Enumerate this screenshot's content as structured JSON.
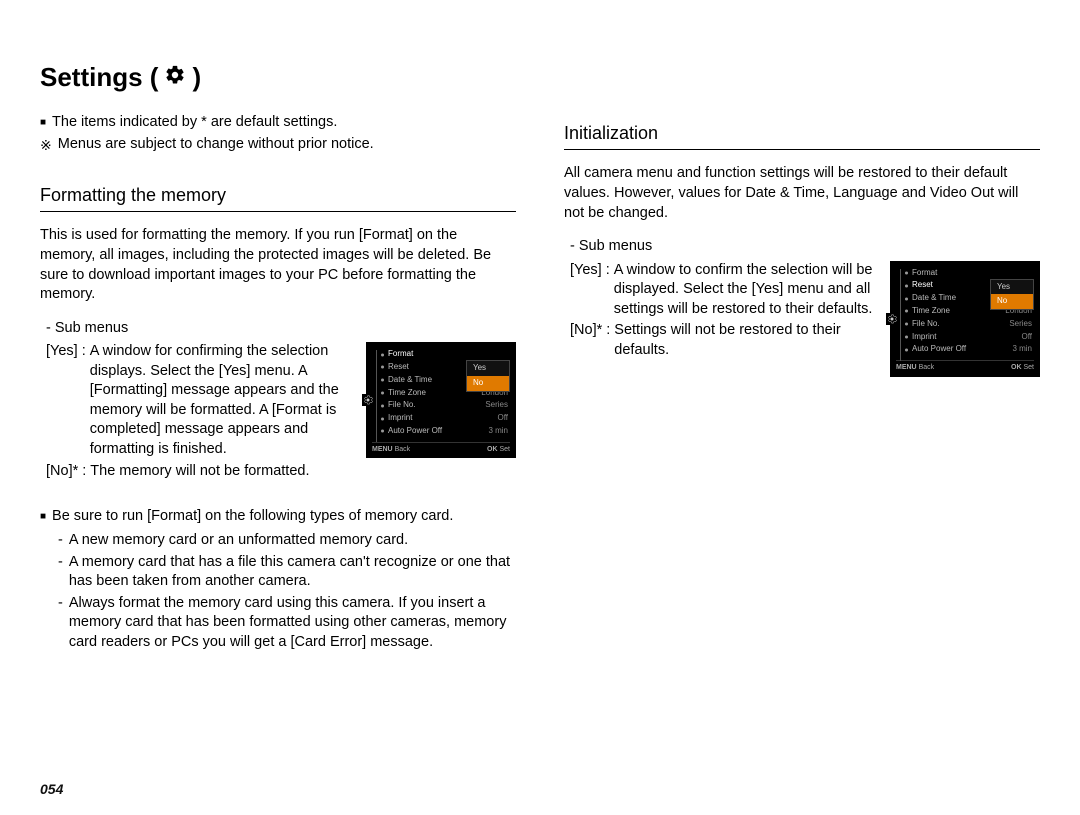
{
  "page_title_prefix": "Settings (",
  "page_title_suffix": ")",
  "page_number": "054",
  "notes": {
    "default_items": "The items indicated by * are default settings.",
    "change_notice": "Menus are subject to change without prior notice."
  },
  "left": {
    "section_title": "Formatting the memory",
    "intro": "This is used for formatting the memory. If you run [Format] on the memory, all images, including the protected images will be deleted. Be sure to download important images to your PC before formatting the memory.",
    "sub_label": "- Sub menus",
    "opts": {
      "yes_key": "[Yes]",
      "yes_val": "A window for confirming the selection displays. Select the [Yes] menu. A [Formatting] message appears and the memory will be formatted. A [Format is completed] message appears and formatting is finished.",
      "no_key": "[No]*",
      "no_val": "The memory will not be formatted."
    },
    "notes2_lead": "Be sure to run [Format] on the following types of memory card.",
    "notes2_items": [
      "A new memory card or an unformatted memory card.",
      "A memory card that has a file this camera can't recognize or one that has been taken from another camera.",
      "Always format the memory card using this camera. If you insert a memory card that has been formatted using other cameras, memory card readers or PCs you will get a [Card Error] message."
    ]
  },
  "right": {
    "section_title": "Initialization",
    "intro": "All camera menu and function settings will be restored to their default values. However, values for Date & Time, Language and Video Out will not be changed.",
    "sub_label": "- Sub menus",
    "opts": {
      "yes_key": "[Yes]",
      "yes_val": "A window to confirm the selection will be displayed. Select the [Yes] menu and all settings will be restored to their defaults.",
      "no_key": "[No]*",
      "no_val": "Settings will not be restored to their defaults."
    }
  },
  "cam_menu": {
    "items": [
      {
        "label": "Format",
        "value": ""
      },
      {
        "label": "Reset",
        "value": ""
      },
      {
        "label": "Date & Time",
        "value": ""
      },
      {
        "label": "Time Zone",
        "value": "London"
      },
      {
        "label": "File No.",
        "value": "Series"
      },
      {
        "label": "Imprint",
        "value": "Off"
      },
      {
        "label": "Auto Power Off",
        "value": "3 min"
      }
    ],
    "popup": {
      "yes": "Yes",
      "no": "No"
    },
    "footer": {
      "back_btn": "MENU",
      "back": "Back",
      "ok_btn": "OK",
      "set": "Set"
    }
  }
}
